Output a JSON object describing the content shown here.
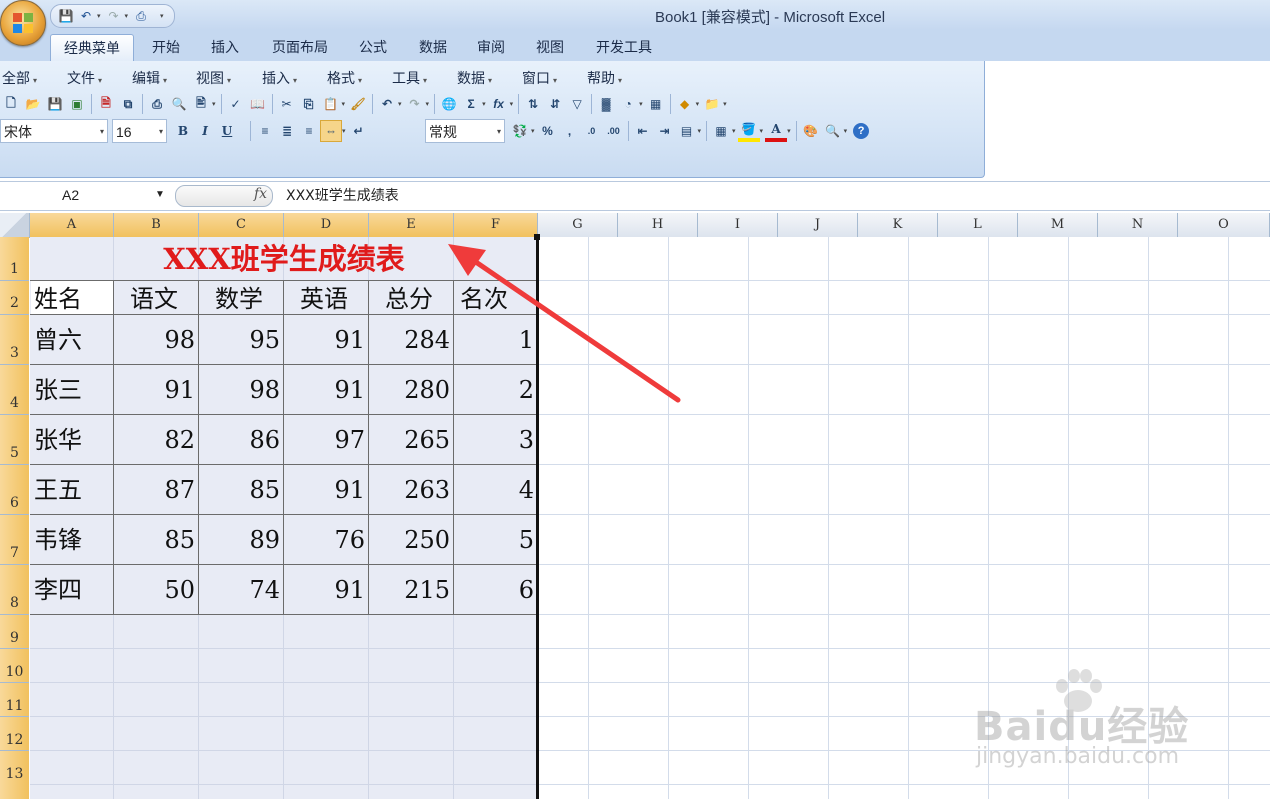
{
  "window": {
    "title": "Book1  [兼容模式] - Microsoft Excel"
  },
  "tabs": [
    {
      "label": "经典菜单",
      "active": true
    },
    {
      "label": "开始"
    },
    {
      "label": "插入"
    },
    {
      "label": "页面布局"
    },
    {
      "label": "公式"
    },
    {
      "label": "数据"
    },
    {
      "label": "审阅"
    },
    {
      "label": "视图"
    },
    {
      "label": "开发工具"
    }
  ],
  "menus": [
    {
      "label": "全部"
    },
    {
      "label": "文件"
    },
    {
      "label": "编辑"
    },
    {
      "label": "视图"
    },
    {
      "label": "插入"
    },
    {
      "label": "格式"
    },
    {
      "label": "工具"
    },
    {
      "label": "数据"
    },
    {
      "label": "窗口"
    },
    {
      "label": "帮助"
    }
  ],
  "font": {
    "name": "宋体",
    "size": "16"
  },
  "number_format": "常规",
  "toolbar": {
    "bold": "B",
    "italic": "I",
    "underline": "U",
    "sigma": "Σ",
    "fx": "fx",
    "percent": "%",
    "comma": ",",
    "inc_decimal": ".0→.00",
    "dec_decimal": ".00→.0",
    "help": "?",
    "font_color_letter": "A"
  },
  "formula_bar": {
    "cell_ref": "A2",
    "fx_label": "fx",
    "content": "XXX班学生成绩表"
  },
  "columns": [
    "A",
    "B",
    "C",
    "D",
    "E",
    "F",
    "G",
    "H",
    "I",
    "J",
    "K",
    "L",
    "M",
    "N",
    "O"
  ],
  "rows": [
    "1",
    "2",
    "3",
    "4",
    "5",
    "6",
    "7",
    "8",
    "9",
    "10",
    "11",
    "12",
    "13"
  ],
  "sheet": {
    "title": "XXX班学生成绩表",
    "headers": [
      "姓名",
      "语文",
      "数学",
      "英语",
      "总分",
      "名次"
    ],
    "data": [
      [
        "曾六",
        "98",
        "95",
        "91",
        "284",
        "1"
      ],
      [
        "张三",
        "91",
        "98",
        "91",
        "280",
        "2"
      ],
      [
        "张华",
        "82",
        "86",
        "97",
        "265",
        "3"
      ],
      [
        "王五",
        "87",
        "85",
        "91",
        "263",
        "4"
      ],
      [
        "韦锋",
        "85",
        "89",
        "76",
        "250",
        "5"
      ],
      [
        "李四",
        "50",
        "74",
        "91",
        "215",
        "6"
      ]
    ]
  },
  "colors": {
    "title_red": "#e01b1b",
    "arrow": "#ef3b3b",
    "selection_fill": "#e8ebf5",
    "header_selected": "#f4c96a"
  },
  "watermark": {
    "brand": "Baidu经验",
    "url": "jingyan.baidu.com"
  }
}
